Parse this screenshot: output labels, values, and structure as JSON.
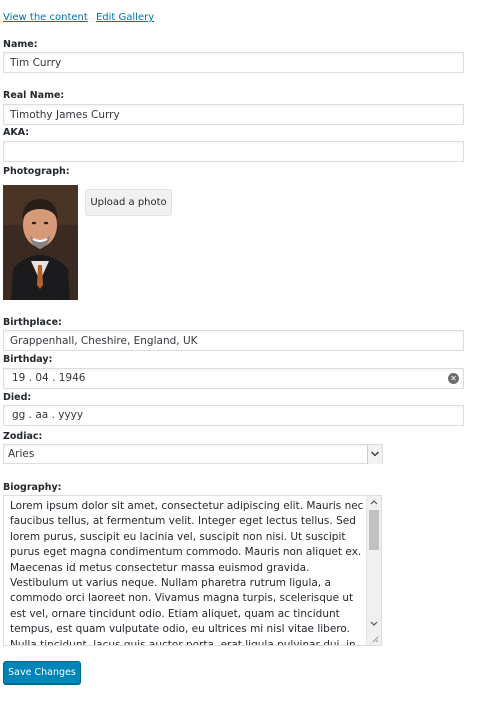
{
  "links": {
    "view_content": "View the content",
    "edit_gallery": "Edit Gallery"
  },
  "fields": {
    "name": {
      "label": "Name:",
      "value": "Tim Curry"
    },
    "real_name": {
      "label": "Real Name:",
      "value": "Timothy James Curry"
    },
    "aka": {
      "label": "AKA:",
      "value": ""
    },
    "photograph": {
      "label": "Photograph:",
      "button": "Upload a photo"
    },
    "birthplace": {
      "label": "Birthplace:",
      "value": "Grappenhall, Cheshire, England, UK"
    },
    "birthday": {
      "label": "Birthday:",
      "value": "19 . 04 . 1946"
    },
    "died": {
      "label": "Died:",
      "placeholder": "gg . aa . yyyy"
    },
    "zodiac": {
      "label": "Zodiac:",
      "value": "Aries"
    },
    "biography": {
      "label": "Biography:",
      "value": "Lorem ipsum dolor sit amet, consectetur adipiscing elit. Mauris nec faucibus tellus, at fermentum velit. Integer eget lectus tellus. Sed lorem purus, suscipit eu lacinia vel, suscipit non nisi. Ut suscipit purus eget magna condimentum commodo. Mauris non aliquet ex. Maecenas id metus consectetur massa euismod gravida. Vestibulum ut varius neque. Nullam pharetra rutrum ligula, a commodo orci laoreet non. Vivamus magna turpis, scelerisque ut est vel, ornare tincidunt odio. Etiam aliquet, quam ac tincidunt tempus, est quam vulputate odio, eu ultrices mi nisl vitae libero. Nulla tincidunt, lacus quis auctor porta, erat ligula pulvinar dui, in tempus ante libero non ante."
    }
  },
  "actions": {
    "save": "Save Changes"
  },
  "colors": {
    "link": "#0073aa",
    "primary_button": "#0085ba"
  }
}
